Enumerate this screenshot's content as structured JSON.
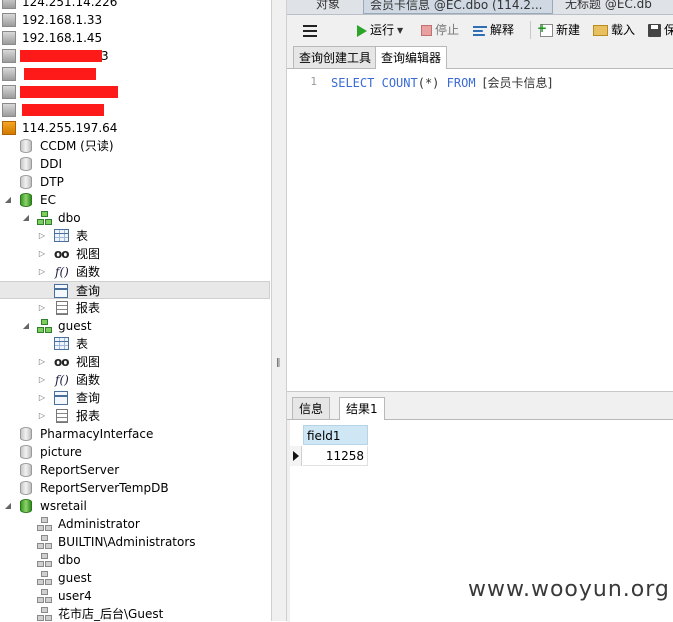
{
  "tree": {
    "redacted_fragment": "3",
    "items": [
      {
        "label": "124.251.14.226",
        "kind": "server"
      },
      {
        "label": "192.168.1.33",
        "kind": "server"
      },
      {
        "label": "192.168.1.45",
        "kind": "server"
      },
      {
        "label": "114.255.197.64",
        "kind": "server-open"
      },
      {
        "label": "CCDM (只读)",
        "kind": "db"
      },
      {
        "label": "DDI",
        "kind": "db"
      },
      {
        "label": "DTP",
        "kind": "db"
      },
      {
        "label": "EC",
        "kind": "db-open"
      },
      {
        "label": "dbo",
        "kind": "schema-open"
      },
      {
        "label": "表",
        "kind": "tables"
      },
      {
        "label": "视图",
        "kind": "views"
      },
      {
        "label": "函数",
        "kind": "functions"
      },
      {
        "label": "查询",
        "kind": "queries",
        "selected": true
      },
      {
        "label": "报表",
        "kind": "reports"
      },
      {
        "label": "guest",
        "kind": "schema-open"
      },
      {
        "label": "表",
        "kind": "tables"
      },
      {
        "label": "视图",
        "kind": "views"
      },
      {
        "label": "函数",
        "kind": "functions"
      },
      {
        "label": "查询",
        "kind": "queries"
      },
      {
        "label": "报表",
        "kind": "reports"
      },
      {
        "label": "PharmacyInterface",
        "kind": "db"
      },
      {
        "label": "picture",
        "kind": "db"
      },
      {
        "label": "ReportServer",
        "kind": "db"
      },
      {
        "label": "ReportServerTempDB",
        "kind": "db"
      },
      {
        "label": "wsretail",
        "kind": "db-open"
      },
      {
        "label": "Administrator",
        "kind": "schema"
      },
      {
        "label": "BUILTIN\\Administrators",
        "kind": "schema"
      },
      {
        "label": "dbo",
        "kind": "schema"
      },
      {
        "label": "guest",
        "kind": "schema"
      },
      {
        "label": "user4",
        "kind": "schema"
      },
      {
        "label": "花市店_后台\\Guest",
        "kind": "schema"
      }
    ]
  },
  "doc_tabs": {
    "objects": "对象",
    "query_tab": "会员卡信息 @EC.dbo (114.2...",
    "untitled_tab": "无标题 @EC.db"
  },
  "toolbar": {
    "run": "运行",
    "stop": "停止",
    "explain": "解释",
    "new": "新建",
    "load": "载入",
    "save": "保"
  },
  "editor_tabs": {
    "builder": "查询创建工具",
    "editor": "查询编辑器"
  },
  "editor": {
    "line_number": "1",
    "tokens": {
      "select": "SELECT",
      "count": "COUNT",
      "args": "(*)",
      "from": "FROM",
      "table": "[会员卡信息]"
    }
  },
  "results": {
    "tabs": {
      "info": "信息",
      "result1": "结果1"
    },
    "columns": [
      "field1"
    ],
    "rows": [
      [
        "11258"
      ]
    ]
  },
  "watermark": "www.wooyun.org",
  "colors": {
    "keyword": "#3a6bd6",
    "selection_bg": "#e8e8e8",
    "grid_header": "#cfe6f5",
    "redaction": "#ff1a1a",
    "run_green": "#2aa52a"
  }
}
